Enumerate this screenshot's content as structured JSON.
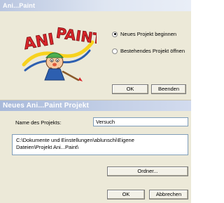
{
  "start_dialog": {
    "title": "Ani...Paint",
    "logo_text": "ANI PAINT",
    "options": [
      {
        "label": "Neues Projekt beginnen",
        "selected": true
      },
      {
        "label": "Bestehendes Projekt öffnen",
        "selected": false
      }
    ],
    "ok_label": "OK",
    "quit_label": "Beenden"
  },
  "new_project_dialog": {
    "title": "Neues Ani...Paint Projekt",
    "name_label": "Name des Projekts:",
    "name_value": "Versuch",
    "path_line1": "C:\\Dokumente und Einstellungen\\ablunschi\\Eigene",
    "path_line2": "Dateien\\Projekt Ani...Paint\\",
    "folder_label": "Ordner...",
    "ok_label": "OK",
    "cancel_label": "Abbrechen"
  },
  "colors": {
    "dialog_bg": "#ece9d8",
    "titlebar_start": "#b9c6e0",
    "titlebar_end": "#e9eef7",
    "logo_red": "#d9252a",
    "logo_green": "#4caf50",
    "logo_yellow": "#f7d21e",
    "logo_blue": "#2d5fb0"
  }
}
